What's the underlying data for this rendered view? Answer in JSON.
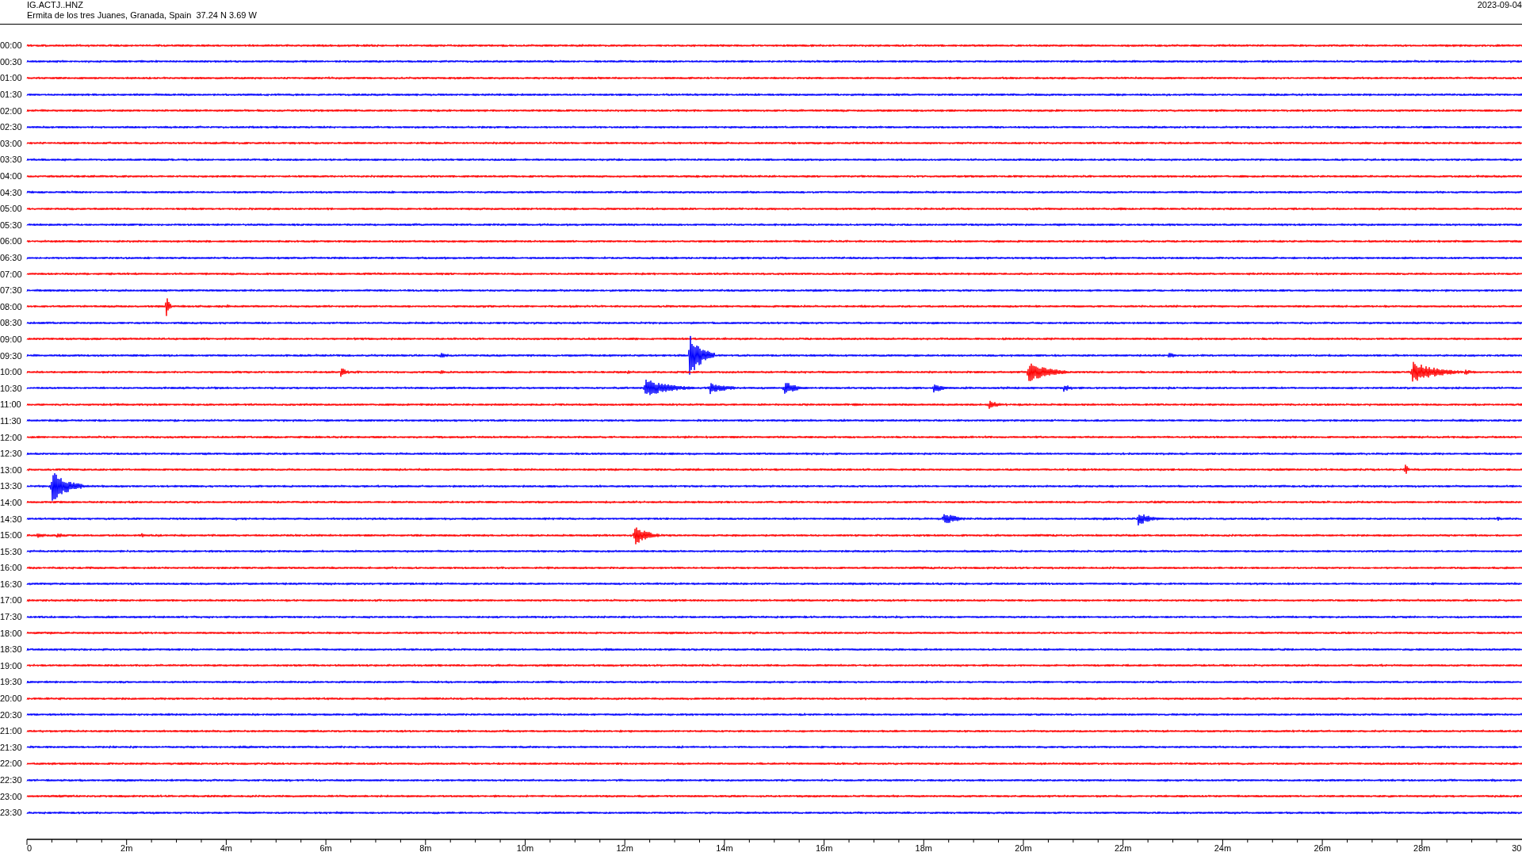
{
  "header": {
    "station": "IG.ACTJ..HNZ",
    "location": "Ermita de los tres Juanes, Granada, Spain  37.24 N 3.69 W",
    "date": "2023-09-04"
  },
  "traces": [
    {
      "time": "00:00",
      "color": "#ff0000"
    },
    {
      "time": "00:30",
      "color": "#0000ff"
    },
    {
      "time": "01:00",
      "color": "#ff0000"
    },
    {
      "time": "01:30",
      "color": "#0000ff"
    },
    {
      "time": "02:00",
      "color": "#ff0000"
    },
    {
      "time": "02:30",
      "color": "#0000ff"
    },
    {
      "time": "03:00",
      "color": "#ff0000"
    },
    {
      "time": "03:30",
      "color": "#0000ff"
    },
    {
      "time": "04:00",
      "color": "#ff0000"
    },
    {
      "time": "04:30",
      "color": "#0000ff"
    },
    {
      "time": "05:00",
      "color": "#ff0000"
    },
    {
      "time": "05:30",
      "color": "#0000ff"
    },
    {
      "time": "06:00",
      "color": "#ff0000"
    },
    {
      "time": "06:30",
      "color": "#0000ff"
    },
    {
      "time": "07:00",
      "color": "#ff0000"
    },
    {
      "time": "07:30",
      "color": "#0000ff"
    },
    {
      "time": "08:00",
      "color": "#ff0000"
    },
    {
      "time": "08:30",
      "color": "#0000ff"
    },
    {
      "time": "09:00",
      "color": "#ff0000"
    },
    {
      "time": "09:30",
      "color": "#0000ff"
    },
    {
      "time": "10:00",
      "color": "#ff0000"
    },
    {
      "time": "10:30",
      "color": "#0000ff"
    },
    {
      "time": "11:00",
      "color": "#ff0000"
    },
    {
      "time": "11:30",
      "color": "#0000ff"
    },
    {
      "time": "12:00",
      "color": "#ff0000"
    },
    {
      "time": "12:30",
      "color": "#0000ff"
    },
    {
      "time": "13:00",
      "color": "#ff0000"
    },
    {
      "time": "13:30",
      "color": "#0000ff"
    },
    {
      "time": "14:00",
      "color": "#ff0000"
    },
    {
      "time": "14:30",
      "color": "#0000ff"
    },
    {
      "time": "15:00",
      "color": "#ff0000"
    },
    {
      "time": "15:30",
      "color": "#0000ff"
    },
    {
      "time": "16:00",
      "color": "#ff0000"
    },
    {
      "time": "16:30",
      "color": "#0000ff"
    },
    {
      "time": "17:00",
      "color": "#ff0000"
    },
    {
      "time": "17:30",
      "color": "#0000ff"
    },
    {
      "time": "18:00",
      "color": "#ff0000"
    },
    {
      "time": "18:30",
      "color": "#0000ff"
    },
    {
      "time": "19:00",
      "color": "#ff0000"
    },
    {
      "time": "19:30",
      "color": "#0000ff"
    },
    {
      "time": "20:00",
      "color": "#ff0000"
    },
    {
      "time": "20:30",
      "color": "#0000ff"
    },
    {
      "time": "21:00",
      "color": "#ff0000"
    },
    {
      "time": "21:30",
      "color": "#0000ff"
    },
    {
      "time": "22:00",
      "color": "#ff0000"
    },
    {
      "time": "22:30",
      "color": "#0000ff"
    },
    {
      "time": "23:00",
      "color": "#ff0000"
    },
    {
      "time": "23:30",
      "color": "#0000ff"
    }
  ],
  "x_axis": {
    "ticks": [
      "0",
      "2m",
      "4m",
      "6m",
      "8m",
      "10m",
      "12m",
      "14m",
      "16m",
      "18m",
      "20m",
      "22m",
      "24m",
      "26m",
      "28m",
      "30"
    ]
  }
}
